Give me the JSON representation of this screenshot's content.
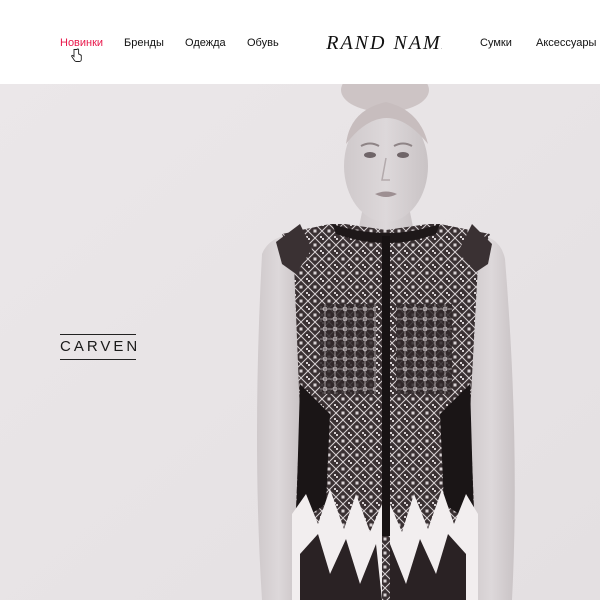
{
  "header": {
    "nav_left": [
      {
        "label": "Новинки",
        "active": true
      },
      {
        "label": "Бренды",
        "active": false
      },
      {
        "label": "Одежда",
        "active": false
      },
      {
        "label": "Обувь",
        "active": false
      }
    ],
    "logo_text": "BRAND NAME",
    "nav_right": [
      {
        "label": "Сумки",
        "active": false
      },
      {
        "label": "Аксессуары",
        "active": false
      }
    ],
    "active_color": "#e8174a"
  },
  "hero": {
    "brand": "CARVEN",
    "image": "fashion-model-photo"
  }
}
